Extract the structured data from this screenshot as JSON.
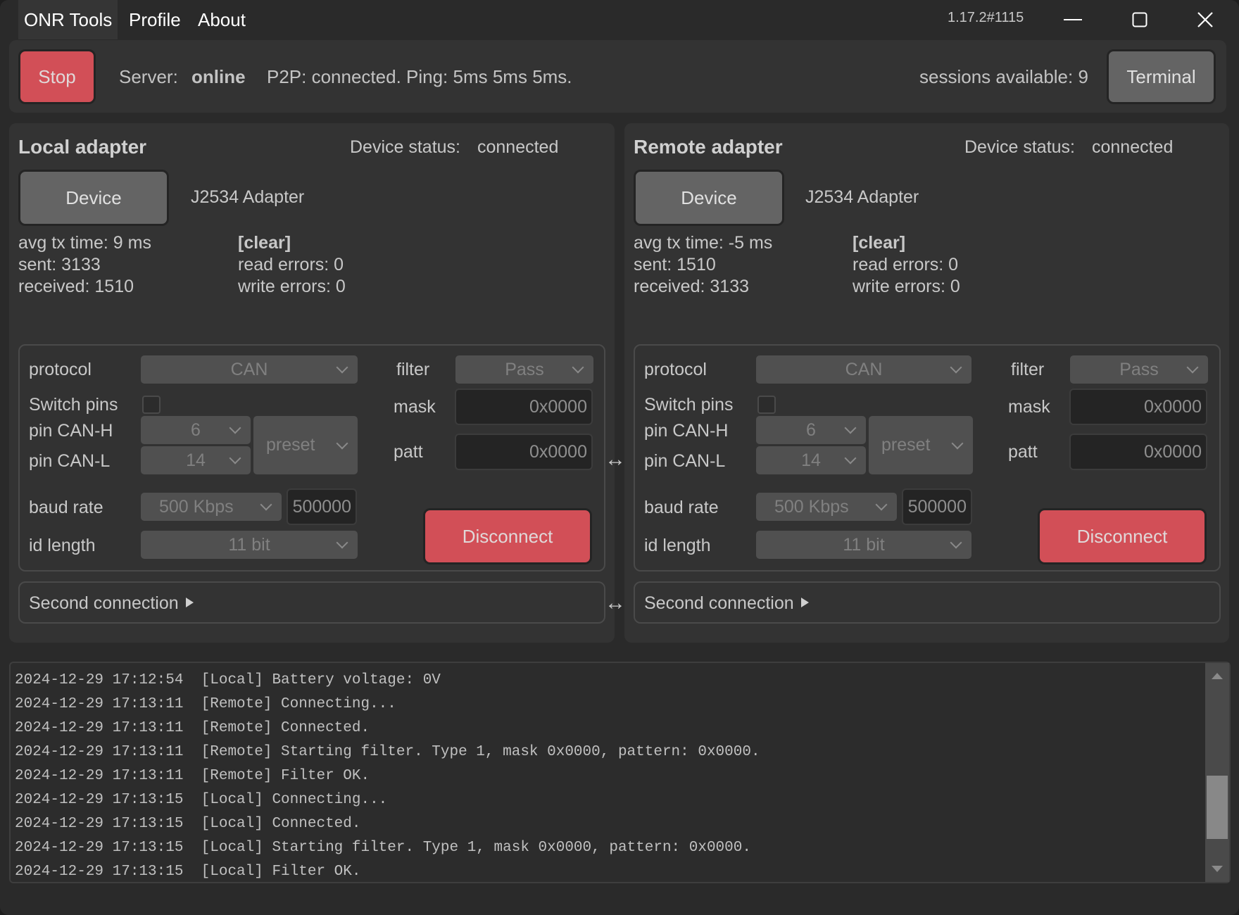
{
  "titlebar": {
    "menu": [
      "ONR Tools",
      "Profile",
      "About"
    ],
    "version": "1.17.2#1115",
    "minimize_icon": "minimize-icon",
    "maximize_icon": "maximize-icon",
    "close_icon": "close-icon"
  },
  "topbar": {
    "stop_label": "Stop",
    "server_label": "Server:",
    "server_status": "online",
    "p2p_status": "P2P: connected. Ping: 5ms 5ms 5ms.",
    "sessions": "sessions available: 9",
    "terminal_label": "Terminal"
  },
  "colors": {
    "danger": "#d24f57",
    "neutral_button": "#646464",
    "panel_bg": "#333333"
  },
  "local": {
    "title": "Local adapter",
    "status_label": "Device status:",
    "status_value": "connected",
    "device_button": "Device",
    "device_name": "J2534 Adapter",
    "avg_tx": "avg tx time: 9 ms",
    "sent": "sent: 3133",
    "received": "received: 1510",
    "clear": "[clear]",
    "read_errors": "read errors: 0",
    "write_errors": "write errors: 0",
    "config": {
      "protocol_label": "protocol",
      "protocol_value": "CAN",
      "switch_pins_label": "Switch pins",
      "switch_pins_checked": false,
      "pin_h_label": "pin CAN-H",
      "pin_h_value": "6",
      "pin_l_label": "pin CAN-L",
      "pin_l_value": "14",
      "preset_value": "preset",
      "baud_label": "baud rate",
      "baud_value": "500 Kbps",
      "baud_custom": "500000",
      "idlen_label": "id length",
      "idlen_value": "11 bit",
      "filter_label": "filter",
      "filter_value": "Pass",
      "mask_label": "mask",
      "mask_value": "0x0000",
      "patt_label": "patt",
      "patt_value": "0x0000",
      "disconnect_label": "Disconnect"
    },
    "second_connection": "Second connection"
  },
  "remote": {
    "title": "Remote adapter",
    "status_label": "Device status:",
    "status_value": "connected",
    "device_button": "Device",
    "device_name": "J2534 Adapter",
    "avg_tx": "avg tx time: -5 ms",
    "sent": "sent: 1510",
    "received": "received: 3133",
    "clear": "[clear]",
    "read_errors": "read errors: 0",
    "write_errors": "write errors: 0",
    "config": {
      "protocol_label": "protocol",
      "protocol_value": "CAN",
      "switch_pins_label": "Switch pins",
      "switch_pins_checked": false,
      "pin_h_label": "pin CAN-H",
      "pin_h_value": "6",
      "pin_l_label": "pin CAN-L",
      "pin_l_value": "14",
      "preset_value": "preset",
      "baud_label": "baud rate",
      "baud_value": "500 Kbps",
      "baud_custom": "500000",
      "idlen_label": "id length",
      "idlen_value": "11 bit",
      "filter_label": "filter",
      "filter_value": "Pass",
      "mask_label": "mask",
      "mask_value": "0x0000",
      "patt_label": "patt",
      "patt_value": "0x0000",
      "disconnect_label": "Disconnect"
    },
    "second_connection": "Second connection"
  },
  "link_arrow": "↔",
  "log": {
    "lines": [
      "2024-12-29 17:12:54  [Local] Battery voltage: 0V",
      "2024-12-29 17:13:11  [Remote] Connecting...",
      "2024-12-29 17:13:11  [Remote] Connected.",
      "2024-12-29 17:13:11  [Remote] Starting filter. Type 1, mask 0x0000, pattern: 0x0000.",
      "2024-12-29 17:13:11  [Remote] Filter OK.",
      "2024-12-29 17:13:15  [Local] Connecting...",
      "2024-12-29 17:13:15  [Local] Connected.",
      "2024-12-29 17:13:15  [Local] Starting filter. Type 1, mask 0x0000, pattern: 0x0000.",
      "2024-12-29 17:13:15  [Local] Filter OK."
    ],
    "scroll_position": 0.85
  }
}
